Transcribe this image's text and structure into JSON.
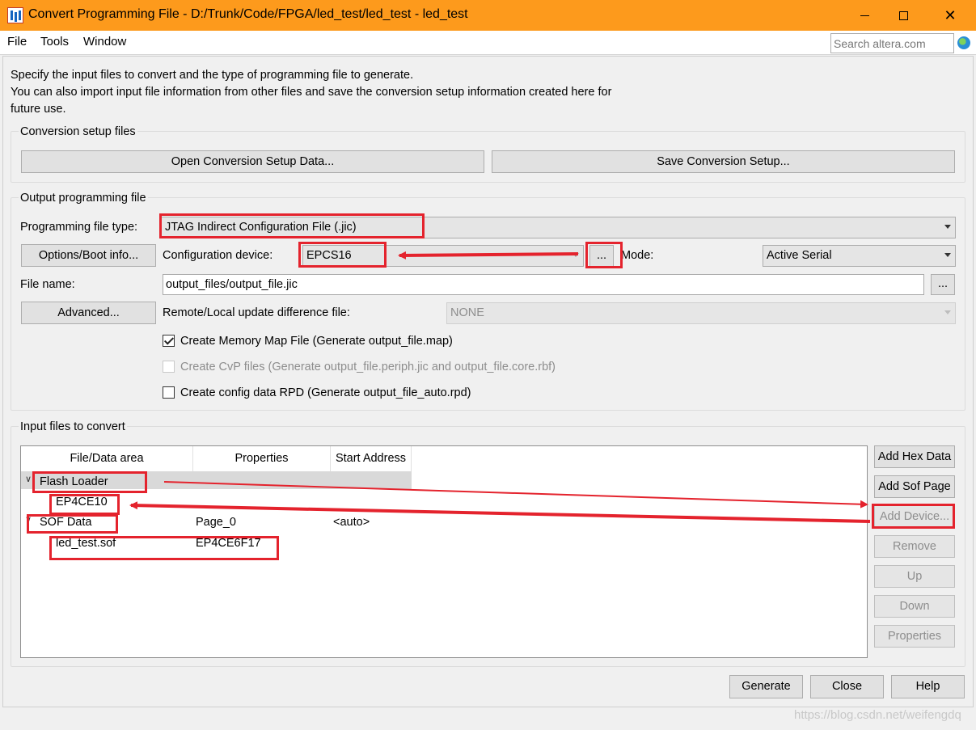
{
  "window": {
    "title": "Convert Programming File - D:/Trunk/Code/FPGA/led_test/led_test - led_test",
    "close_glyph": "✕"
  },
  "menu": {
    "file": "File",
    "tools": "Tools",
    "window": "Window"
  },
  "search": {
    "placeholder": "Search altera.com"
  },
  "description": {
    "line1": "Specify the input files to convert and the type of programming file to generate.",
    "line2": "You can also import input file information from other files and save the conversion setup information created here for",
    "line3": "future use."
  },
  "conversion_setup": {
    "title": "Conversion setup files",
    "open_label": "Open Conversion Setup Data...",
    "save_label": "Save Conversion Setup..."
  },
  "output": {
    "title": "Output programming file",
    "file_type_label": "Programming file type:",
    "file_type_value": "JTAG Indirect Configuration File (.jic)",
    "options_label": "Options/Boot info...",
    "config_device_label": "Configuration device:",
    "config_device_value": "EPCS16",
    "browse_label": "...",
    "mode_label": "Mode:",
    "mode_value": "Active Serial",
    "file_name_label": "File name:",
    "file_name_value": "output_files/output_file.jic",
    "advanced_label": "Advanced...",
    "remote_label": "Remote/Local update difference file:",
    "remote_value": "NONE",
    "create_map_label": "Create Memory Map File (Generate output_file.map)",
    "create_map_checked": true,
    "create_cvp_label": "Create CvP files (Generate output_file.periph.jic and output_file.core.rbf)",
    "create_cvp_checked": false,
    "create_rpd_label": "Create config data RPD (Generate output_file_auto.rpd)",
    "create_rpd_checked": false
  },
  "input": {
    "title": "Input files to convert",
    "columns": [
      "File/Data area",
      "Properties",
      "Start Address"
    ],
    "rows": [
      {
        "name": "Flash Loader",
        "properties": "",
        "address": ""
      },
      {
        "name": "EP4CE10",
        "properties": "",
        "address": ""
      },
      {
        "name": "SOF Data",
        "properties": "Page_0",
        "address": "<auto>"
      },
      {
        "name": "led_test.sof",
        "properties": "EP4CE6F17",
        "address": ""
      }
    ],
    "buttons": {
      "add_hex": "Add Hex Data",
      "add_sof": "Add Sof Page",
      "add_device": "Add Device...",
      "remove": "Remove",
      "up": "Up",
      "down": "Down",
      "properties": "Properties"
    }
  },
  "footer": {
    "generate": "Generate",
    "close": "Close",
    "help": "Help"
  },
  "watermark": "https://blog.csdn.net/weifengdq",
  "colors": {
    "titlebar": "#fd9a1c",
    "annotation": "#e4232d"
  }
}
